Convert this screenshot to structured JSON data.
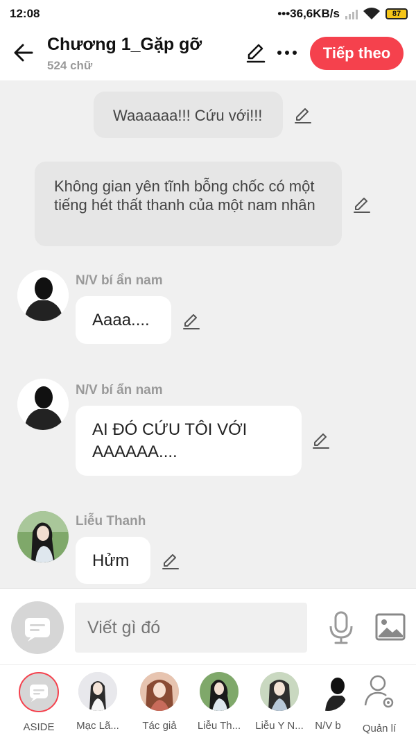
{
  "status_bar": {
    "time": "12:08",
    "network": "•••36,6KB/s",
    "battery": "87"
  },
  "header": {
    "title": "Chương 1_Gặp gỡ",
    "word_count": "524 chữ",
    "next_label": "Tiếp theo"
  },
  "messages": {
    "m1": {
      "text": "Waaaaaa!!! Cứu với!!!"
    },
    "m2": {
      "text": "Không gian yên tĩnh bỗng chốc có một tiếng hét thất thanh của một nam nhân"
    },
    "m3": {
      "name": "N/V bí ẩn nam",
      "text": "Aaaa...."
    },
    "m4": {
      "name": "N/V bí ẩn nam",
      "text_line1": "AI ĐÓ CỨU TÔI VỚI",
      "text_line2": "AAAAAA...."
    },
    "m5": {
      "name": "Liễu Thanh",
      "text": "Hửm"
    }
  },
  "composer": {
    "placeholder": "Viết gì đó"
  },
  "character_bar": {
    "items": [
      {
        "label": "ASIDE"
      },
      {
        "label": "Mạc Lã..."
      },
      {
        "label": "Tác giả"
      },
      {
        "label": "Liễu Th..."
      },
      {
        "label": "Liễu Y N..."
      },
      {
        "label": "N/V b"
      },
      {
        "label": "Quản lí"
      }
    ]
  },
  "colors": {
    "accent": "#f5414d",
    "narration_bg": "#e6e6e6",
    "chat_bg": "#f0f0f0"
  }
}
